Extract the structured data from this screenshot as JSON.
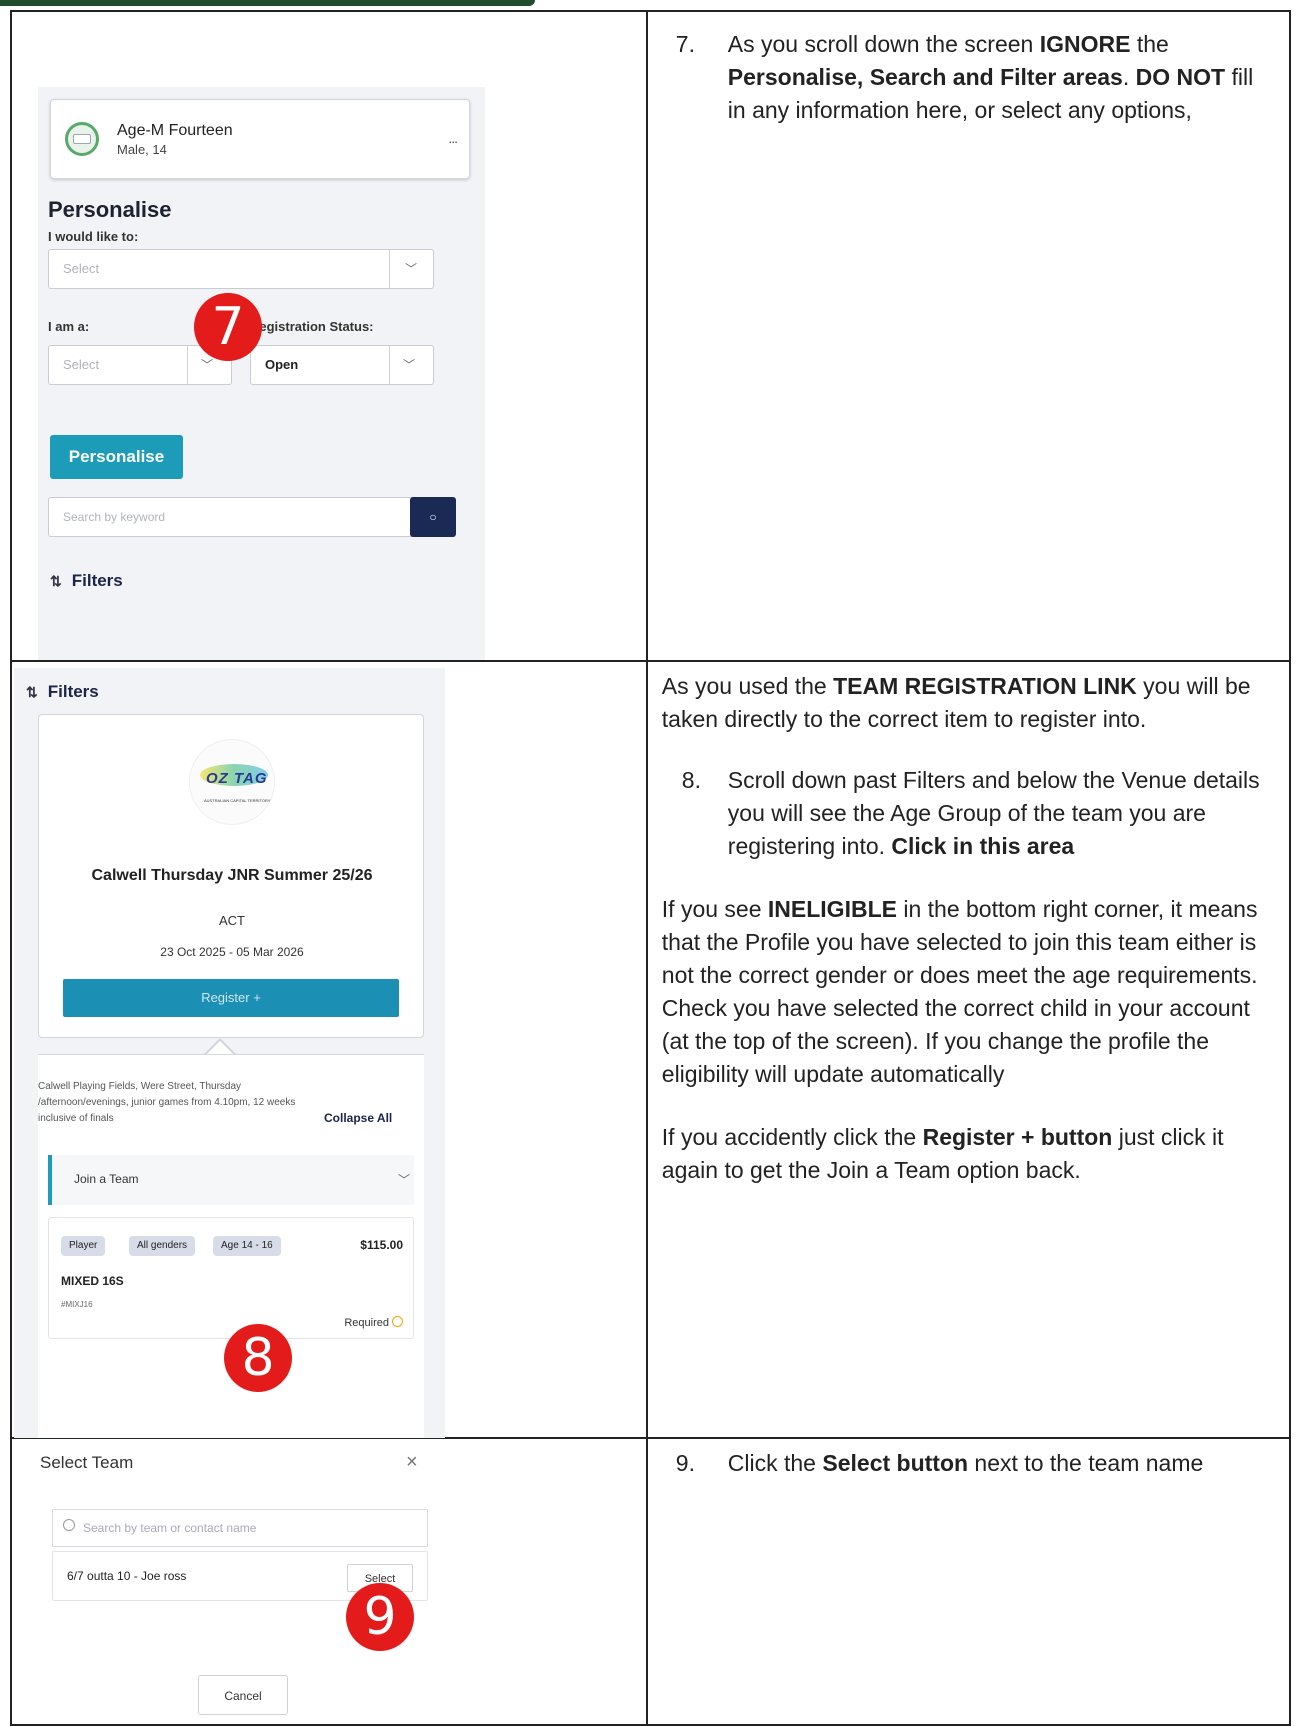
{
  "row1": {
    "screenshot": {
      "profile_name": "Age-M Fourteen",
      "profile_sub": "Male, 14",
      "more": "...",
      "heading": "Personalise",
      "would_like_label": "I would like to:",
      "would_like_placeholder": "Select",
      "i_am_label": "I am a:",
      "i_am_placeholder": "Select",
      "reg_status_label": "Registration Status:",
      "reg_status_value": "Open",
      "personalise_button": "Personalise",
      "search_placeholder": "Search by keyword",
      "filters_label": "Filters",
      "badge": "7"
    },
    "instruction": {
      "number": "7.",
      "t1": "As you scroll down the screen ",
      "b1": "IGNORE",
      "t2": " the ",
      "b2": "Personalise, Search and Filter areas",
      "t3": ".  ",
      "b3": "DO NOT",
      "t4": " fill in any information here, or select any options,"
    }
  },
  "row2": {
    "screenshot": {
      "filters_label": "Filters",
      "logo_text": "OZ TAG",
      "logo_sub": "AUSTRALIAN CAPITAL TERRITORY",
      "event_title": "Calwell Thursday JNR Summer 25/26",
      "event_state": "ACT",
      "event_dates": "23 Oct 2025 - 05 Mar 2026",
      "register_button": "Register +",
      "venue_text": "Calwell Playing Fields, Were Street, Thursday /afternoon/evenings, junior games from 4.10pm, 12 weeks inclusive of finals",
      "collapse_all": "Collapse All",
      "join_team": "Join a Team",
      "pills": [
        "Player",
        "All genders",
        "Age 14 - 16"
      ],
      "price": "$115.00",
      "item_name": "MIXED 16S",
      "item_code": "#MIXJ16",
      "required": "Required",
      "badge": "8"
    },
    "instruction": {
      "p1_t1": "As you used the ",
      "p1_b1": "TEAM REGISTRATION LINK",
      "p1_t2": " you will be taken directly to the correct item to register into.",
      "number": "8.",
      "s8_t1": "Scroll down past Filters and below the Venue details you will see the Age Group of the team you are registering into.  ",
      "s8_b1": "Click in this area",
      "p2_t1": "If you see ",
      "p2_b1": "INELIGIBLE",
      "p2_t2": " in the bottom right corner, it means that the Profile you have selected to join this team either is not the correct gender or does meet the age requirements.  Check you have selected the correct child in your account (at the top of the screen).  If you change the profile the eligibility will update automatically",
      "p3_t1": "If you accidently click the ",
      "p3_b1": "Register + button",
      "p3_t2": " just click it again to get the Join a Team option back."
    }
  },
  "row3": {
    "screenshot": {
      "title": "Select Team",
      "close": "×",
      "search_placeholder": "Search by team or contact name",
      "team_name": "6/7 outta 10 - Joe ross",
      "select_button": "Select",
      "cancel_button": "Cancel",
      "badge": "9"
    },
    "instruction": {
      "number": "9.",
      "t1": "Click the ",
      "b1": "Select button",
      "t2": " next to the team name"
    }
  },
  "colors": {
    "accent": "#1c9cb8",
    "navy": "#1a2a55",
    "badge_red": "#e31b1b",
    "header_green": "#1f4d2e"
  }
}
